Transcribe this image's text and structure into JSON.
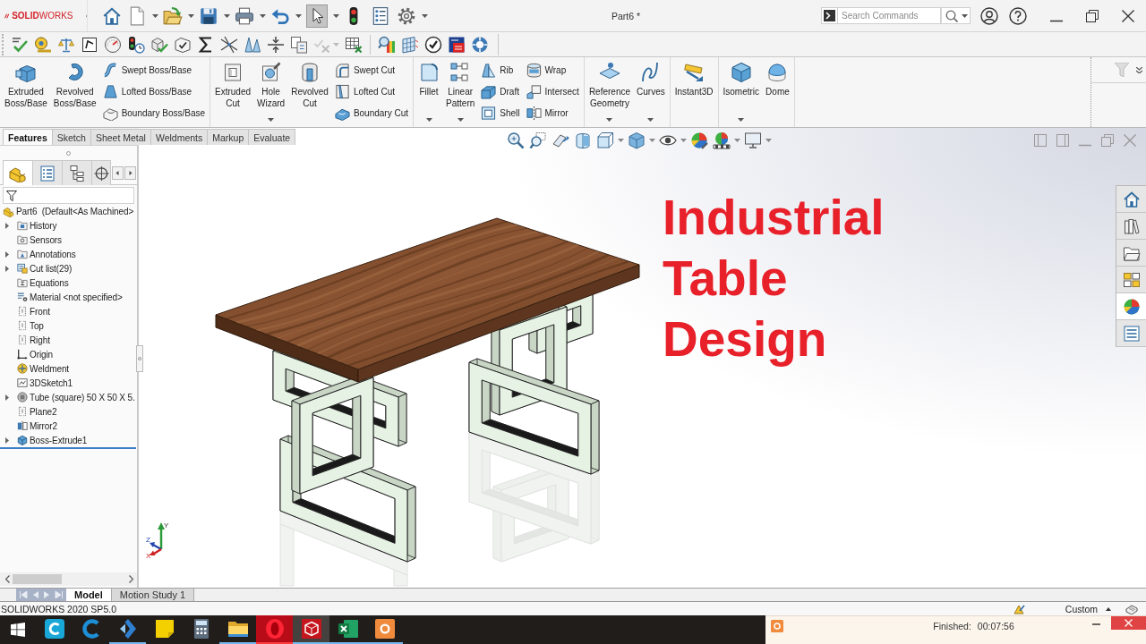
{
  "title_bar": {
    "logo": "**SOLID**WORKS",
    "select_tool": {
      "on": true
    },
    "document_title": "Part6 *",
    "search": {
      "placeholder": "Search Commands"
    }
  },
  "toolbar": [
    {
      "disabled": false
    },
    {
      "disabled": false
    },
    {
      "disabled": false
    },
    {
      "disabled": false
    },
    {
      "disabled": false
    },
    {
      "disabled": false
    },
    {
      "disabled": false
    },
    {
      "disabled": false
    },
    {
      "disabled": false
    },
    {
      "disabled": false
    },
    {
      "disabled": false
    },
    {
      "disabled": false
    },
    {
      "disabled": false
    },
    {
      "disabled": true
    },
    {
      "disabled": false
    },
    {
      "disabled": false
    },
    {
      "disabled": false
    },
    {
      "disabled": false
    },
    {
      "disabled": false
    },
    {
      "disabled": false
    }
  ],
  "ribbon": {
    "groups": [
      {
        "items": [
          {
            "label": "Extruded Boss/Base",
            "kind": "large",
            "menu": false
          },
          {
            "label": "Revolved Boss/Base",
            "kind": "large",
            "menu": false
          },
          {
            "label": "Swept Boss/Base",
            "kind": "small",
            "menu": false
          },
          {
            "label": "Lofted Boss/Base",
            "kind": "small",
            "menu": false
          },
          {
            "label": "Boundary Boss/Base",
            "kind": "small",
            "menu": false
          }
        ]
      },
      {
        "items": [
          {
            "label": "Extruded Cut",
            "kind": "large",
            "menu": false
          },
          {
            "label": "Hole Wizard",
            "kind": "large",
            "menu": true
          },
          {
            "label": "Revolved Cut",
            "kind": "large",
            "menu": false
          },
          {
            "label": "Swept Cut",
            "kind": "small",
            "menu": false
          },
          {
            "label": "Lofted Cut",
            "kind": "small",
            "menu": false
          },
          {
            "label": "Boundary Cut",
            "kind": "small",
            "menu": false
          }
        ]
      },
      {
        "items": [
          {
            "label": "Fillet",
            "kind": "large",
            "menu": true
          },
          {
            "label": "Linear Pattern",
            "kind": "large",
            "menu": true
          },
          {
            "label": "Rib",
            "kind": "small",
            "menu": false
          },
          {
            "label": "Draft",
            "kind": "small",
            "menu": false
          },
          {
            "label": "Shell",
            "kind": "small",
            "menu": false
          },
          {
            "label": "Wrap",
            "kind": "small",
            "menu": false
          },
          {
            "label": "Intersect",
            "kind": "small",
            "menu": false
          },
          {
            "label": "Mirror",
            "kind": "small",
            "menu": false
          }
        ]
      },
      {
        "items": [
          {
            "label": "Reference Geometry",
            "kind": "large",
            "menu": true
          },
          {
            "label": "Curves",
            "kind": "large",
            "menu": true
          }
        ]
      },
      {
        "items": [
          {
            "label": "Instant3D",
            "kind": "large",
            "menu": false
          }
        ]
      },
      {
        "items": [
          {
            "label": "Isometric",
            "kind": "large",
            "menu": true
          },
          {
            "label": "Dome",
            "kind": "large",
            "menu": false
          }
        ]
      }
    ]
  },
  "command_tabs": [
    {
      "label": "Features",
      "selected": true
    },
    {
      "label": "Sketch",
      "selected": false
    },
    {
      "label": "Sheet Metal",
      "selected": false
    },
    {
      "label": "Weldments",
      "selected": false
    },
    {
      "label": "Markup",
      "selected": false
    },
    {
      "label": "Evaluate",
      "selected": false
    }
  ],
  "feature_tree": {
    "panel_tabs": [
      {
        "selected": true
      },
      {
        "selected": false
      },
      {
        "selected": false
      },
      {
        "selected": false
      }
    ],
    "root": "Part6  (Default<As Machined>",
    "items": [
      {
        "label": "History",
        "expandable": true
      },
      {
        "label": "Sensors",
        "expandable": false
      },
      {
        "label": "Annotations",
        "expandable": true
      },
      {
        "label": "Cut list(29)",
        "expandable": true
      },
      {
        "label": "Equations",
        "expandable": false
      },
      {
        "label": "Material <not specified>",
        "expandable": false
      },
      {
        "label": "Front",
        "expandable": false
      },
      {
        "label": "Top",
        "expandable": false
      },
      {
        "label": "Right",
        "expandable": false
      },
      {
        "label": "Origin",
        "expandable": false
      },
      {
        "label": "Weldment",
        "expandable": false
      },
      {
        "label": "3DSketch1",
        "expandable": false
      },
      {
        "label": "Tube (square) 50 X 50 X 5.",
        "expandable": true
      },
      {
        "label": "Plane2",
        "expandable": false
      },
      {
        "label": "Mirror2",
        "expandable": false
      },
      {
        "label": "Boss-Extrude1",
        "expandable": true
      }
    ]
  },
  "viewport": {
    "overlay_title": "Industrial Table Design",
    "triad": {
      "y": "Y",
      "z": "Z",
      "x": "X"
    },
    "task_pane": [
      {
        "selected": false
      },
      {
        "selected": false
      },
      {
        "selected": false
      },
      {
        "selected": false
      },
      {
        "selected": true
      },
      {
        "selected": false
      }
    ]
  },
  "bottom_tabs": [
    {
      "label": "Model",
      "selected": true
    },
    {
      "label": "Motion Study 1",
      "selected": false
    }
  ],
  "status_bar": {
    "version": "SOLIDWORKS 2020 SP5.0",
    "units": "Custom"
  },
  "taskbar": [
    {
      "running": false,
      "selected": false,
      "flashing": false
    },
    {
      "running": false,
      "selected": false,
      "flashing": false
    },
    {
      "running": true,
      "selected": false,
      "flashing": false
    },
    {
      "running": false,
      "selected": false,
      "flashing": false
    },
    {
      "running": false,
      "selected": false,
      "flashing": false
    },
    {
      "running": true,
      "selected": false,
      "flashing": false
    },
    {
      "running": true,
      "selected": false,
      "flashing": true
    },
    {
      "running": true,
      "selected": true,
      "flashing": false
    },
    {
      "running": true,
      "selected": false,
      "flashing": false
    },
    {
      "running": true,
      "selected": false,
      "flashing": false
    }
  ],
  "recorder": {
    "status": "Finished:",
    "elapsed": "00:07:56"
  }
}
